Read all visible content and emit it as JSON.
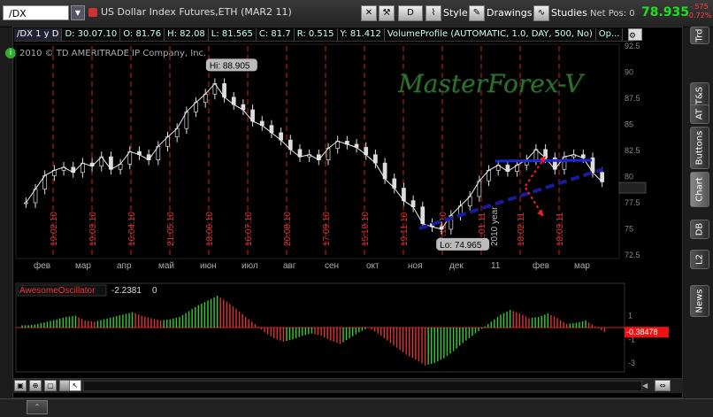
{
  "toolbar": {
    "symbol": "/DX",
    "description": "US Dollar Index Futures,ETH (MAR2 11)",
    "d_button": "D",
    "style_label": "Style",
    "drawings_label": "Drawings",
    "studies_label": "Studies",
    "net_pos_label": "Net Pos: 0",
    "last_price": "78.935",
    "change": "-.575",
    "change_pct": "-0.72%",
    "colors": {
      "last_price": "#22dd22",
      "change": "#ff4444"
    }
  },
  "info_bar": {
    "symbol_period": "/DX 1 y D",
    "date": "D: 30.07.10",
    "open": "O: 81.76",
    "high": "H: 82.08",
    "low": "L: 81.565",
    "close": "C: 81.7",
    "range": "R: 0.515",
    "y": "Y: 81.412",
    "study": "VolumeProfile (AUTOMATIC, 1.0, DAY, 500, No)",
    "more": "Op..."
  },
  "copyright": "2010 © TD AMERITRADE IP Company, Inc.",
  "watermark": "MasterForex-V",
  "hi_label": "Hi: 88.905",
  "lo_label": "Lo: 74.965",
  "year_label": "2010 year",
  "price_axis": [
    "92.5",
    "90",
    "87.5",
    "85",
    "82.5",
    "80",
    "77.5",
    "75",
    "72.5"
  ],
  "month_axis": [
    "фев",
    "мар",
    "апр",
    "май",
    "июн",
    "июл",
    "авг",
    "сен",
    "окт",
    "ноя",
    "дек",
    "11",
    "фев",
    "мар"
  ],
  "vertical_dates": [
    "19.02.10",
    "19.03.10",
    "16.04.10",
    "21.05.10",
    "18.06.10",
    "16.07.10",
    "20.08.10",
    "17.09.10",
    "15.10.10",
    "19.11.10",
    "17.12.10",
    "21.01.11",
    "18.02.11",
    "18.03.11"
  ],
  "oscillator": {
    "name": "AwesomeOscillator",
    "value": "-2.2381",
    "zero": "0",
    "current": "-0.38478",
    "axis": [
      "1",
      "-1",
      "-3"
    ]
  },
  "sidebar_tabs": [
    "Trd",
    "T&S",
    "AT",
    "Buttons",
    "Chart",
    "DB",
    "L2",
    "News"
  ],
  "chart_data": {
    "type": "candlestick",
    "title": "",
    "x_axis": [
      "фев",
      "мар",
      "апр",
      "май",
      "июн",
      "июл",
      "авг",
      "сен",
      "окт",
      "ноя",
      "дек",
      "11",
      "фев",
      "мар"
    ],
    "ylim": [
      72.5,
      92.5
    ],
    "series": [
      {
        "values": [
          77.5,
          78.8,
          80.1,
          80.6,
          80.9,
          80.4,
          81.3,
          81.0,
          81.9,
          80.7,
          81.2,
          82.4,
          82.1,
          81.6,
          82.9,
          83.8,
          84.6,
          86.2,
          87.1,
          87.9,
          88.905,
          87.6,
          86.9,
          86.4,
          85.3,
          84.9,
          84.2,
          83.5,
          82.6,
          81.9,
          82.1,
          81.6,
          82.7,
          83.4,
          83.1,
          82.8,
          82.1,
          81.3,
          79.8,
          78.9,
          77.7,
          77.1,
          75.5,
          75.2,
          74.965,
          76.3,
          77.2,
          78.1,
          79.6,
          80.6,
          81.1,
          80.5,
          81.1,
          81.6,
          82.6,
          81.8,
          80.7,
          81.9,
          82.1,
          81.8,
          80.4,
          79.5
        ]
      }
    ],
    "annotations": {
      "high": "Hi: 88.905",
      "low": "Lo: 74.965"
    },
    "indicator": {
      "name": "AwesomeOscillator",
      "values": [
        0.2,
        0.3,
        0.5,
        0.7,
        0.9,
        1.0,
        0.6,
        0.5,
        0.7,
        0.9,
        1.1,
        1.3,
        1.0,
        0.8,
        0.6,
        0.7,
        0.9,
        1.4,
        1.9,
        2.3,
        2.7,
        2.2,
        1.6,
        0.9,
        0.3,
        -0.4,
        -0.9,
        -1.2,
        -1.0,
        -0.7,
        -0.5,
        -0.7,
        -1.1,
        -1.4,
        -0.9,
        -0.4,
        0.0,
        -0.5,
        -1.1,
        -1.7,
        -2.3,
        -2.7,
        -3.2,
        -3.0,
        -2.6,
        -2.0,
        -1.3,
        -0.7,
        -0.1,
        0.5,
        1.1,
        1.5,
        1.2,
        0.8,
        0.9,
        1.2,
        0.8,
        0.3,
        0.4,
        0.6,
        0.1,
        -0.38478
      ],
      "ylim": [
        -3.6,
        3.0
      ]
    }
  }
}
